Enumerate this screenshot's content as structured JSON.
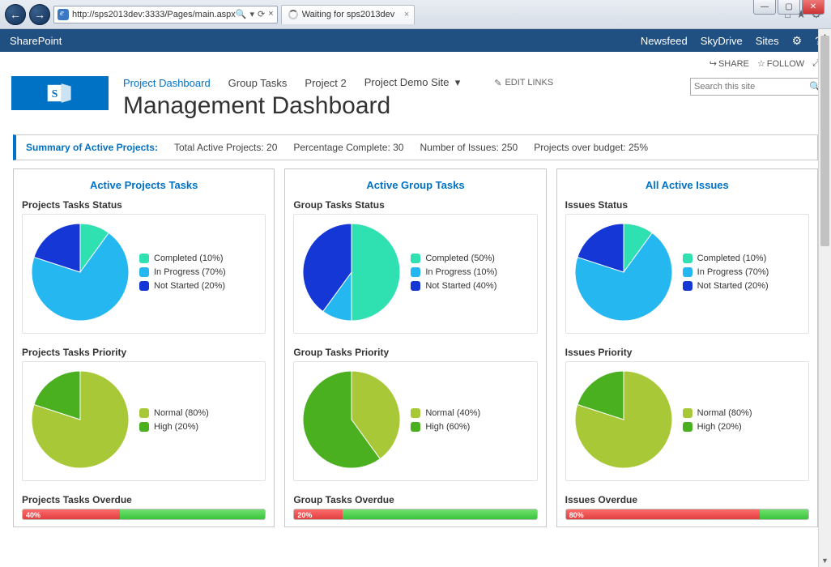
{
  "browser": {
    "url": "http://sps2013dev:3333/Pages/main.aspx",
    "tab_label": "Waiting for sps2013dev",
    "refresh_glyph": "⟳",
    "stop_glyph": "×",
    "search_glyph": "🔍"
  },
  "sp_bar": {
    "brand": "SharePoint",
    "links": [
      "Newsfeed",
      "SkyDrive",
      "Sites"
    ]
  },
  "actions": {
    "share": "SHARE",
    "follow": "FOLLOW"
  },
  "nav": {
    "items": [
      "Project Dashboard",
      "Group Tasks",
      "Project 2",
      "Project Demo Site"
    ],
    "edit_links": "EDIT LINKS",
    "page_title": "Management Dashboard",
    "search_placeholder": "Search this site"
  },
  "summary": {
    "header": "Summary of Active Projects:",
    "total_label": "Total Active Projects:",
    "total_value": "20",
    "pct_label": "Percentage Complete:",
    "pct_value": "30",
    "issues_label": "Number of Issues:",
    "issues_value": "250",
    "budget_label": "Projects over budget:",
    "budget_value": "25%"
  },
  "cards": [
    {
      "title": "Active Projects Tasks",
      "status_title": "Projects Tasks Status",
      "priority_title": "Projects Tasks Priority",
      "overdue_title": "Projects Tasks Overdue",
      "overdue_pct": 40
    },
    {
      "title": "Active Group Tasks",
      "status_title": "Group Tasks Status",
      "priority_title": "Group Tasks Priority",
      "overdue_title": "Group Tasks Overdue",
      "overdue_pct": 20
    },
    {
      "title": "All Active Issues",
      "status_title": "Issues Status",
      "priority_title": "Issues Priority",
      "overdue_title": "Issues Overdue",
      "overdue_pct": 80
    }
  ],
  "colors": {
    "completed": "#2fe0b0",
    "in_progress": "#25b7f0",
    "not_started": "#1437d6",
    "normal": "#a9c837",
    "high": "#4bb020"
  },
  "chart_data": [
    {
      "type": "pie",
      "title": "Projects Tasks Status",
      "series": [
        {
          "name": "Completed",
          "value": 10,
          "color": "#2fe0b0",
          "label": "Completed (10%)"
        },
        {
          "name": "In Progress",
          "value": 70,
          "color": "#25b7f0",
          "label": "In Progress (70%)"
        },
        {
          "name": "Not Started",
          "value": 20,
          "color": "#1437d6",
          "label": "Not Started (20%)"
        }
      ]
    },
    {
      "type": "pie",
      "title": "Group Tasks Status",
      "series": [
        {
          "name": "Completed",
          "value": 50,
          "color": "#2fe0b0",
          "label": "Completed (50%)"
        },
        {
          "name": "In Progress",
          "value": 10,
          "color": "#25b7f0",
          "label": "In Progress (10%)"
        },
        {
          "name": "Not Started",
          "value": 40,
          "color": "#1437d6",
          "label": "Not Started (40%)"
        }
      ]
    },
    {
      "type": "pie",
      "title": "Issues Status",
      "series": [
        {
          "name": "Completed",
          "value": 10,
          "color": "#2fe0b0",
          "label": "Completed (10%)"
        },
        {
          "name": "In Progress",
          "value": 70,
          "color": "#25b7f0",
          "label": "In Progress (70%)"
        },
        {
          "name": "Not Started",
          "value": 20,
          "color": "#1437d6",
          "label": "Not Started (20%)"
        }
      ]
    },
    {
      "type": "pie",
      "title": "Projects Tasks Priority",
      "series": [
        {
          "name": "Normal",
          "value": 80,
          "color": "#a9c837",
          "label": "Normal (80%)"
        },
        {
          "name": "High",
          "value": 20,
          "color": "#4bb020",
          "label": "High (20%)"
        }
      ]
    },
    {
      "type": "pie",
      "title": "Group Tasks Priority",
      "series": [
        {
          "name": "Normal",
          "value": 40,
          "color": "#a9c837",
          "label": "Normal (40%)"
        },
        {
          "name": "High",
          "value": 60,
          "color": "#4bb020",
          "label": "High (60%)"
        }
      ]
    },
    {
      "type": "pie",
      "title": "Issues Priority",
      "series": [
        {
          "name": "Normal",
          "value": 80,
          "color": "#a9c837",
          "label": "Normal (80%)"
        },
        {
          "name": "High",
          "value": 20,
          "color": "#4bb020",
          "label": "High (20%)"
        }
      ]
    },
    {
      "type": "bar",
      "title": "Projects Tasks Overdue",
      "categories": [
        "Overdue"
      ],
      "values": [
        40
      ],
      "ylim": [
        0,
        100
      ]
    },
    {
      "type": "bar",
      "title": "Group Tasks Overdue",
      "categories": [
        "Overdue"
      ],
      "values": [
        20
      ],
      "ylim": [
        0,
        100
      ]
    },
    {
      "type": "bar",
      "title": "Issues Overdue",
      "categories": [
        "Overdue"
      ],
      "values": [
        80
      ],
      "ylim": [
        0,
        100
      ]
    }
  ]
}
